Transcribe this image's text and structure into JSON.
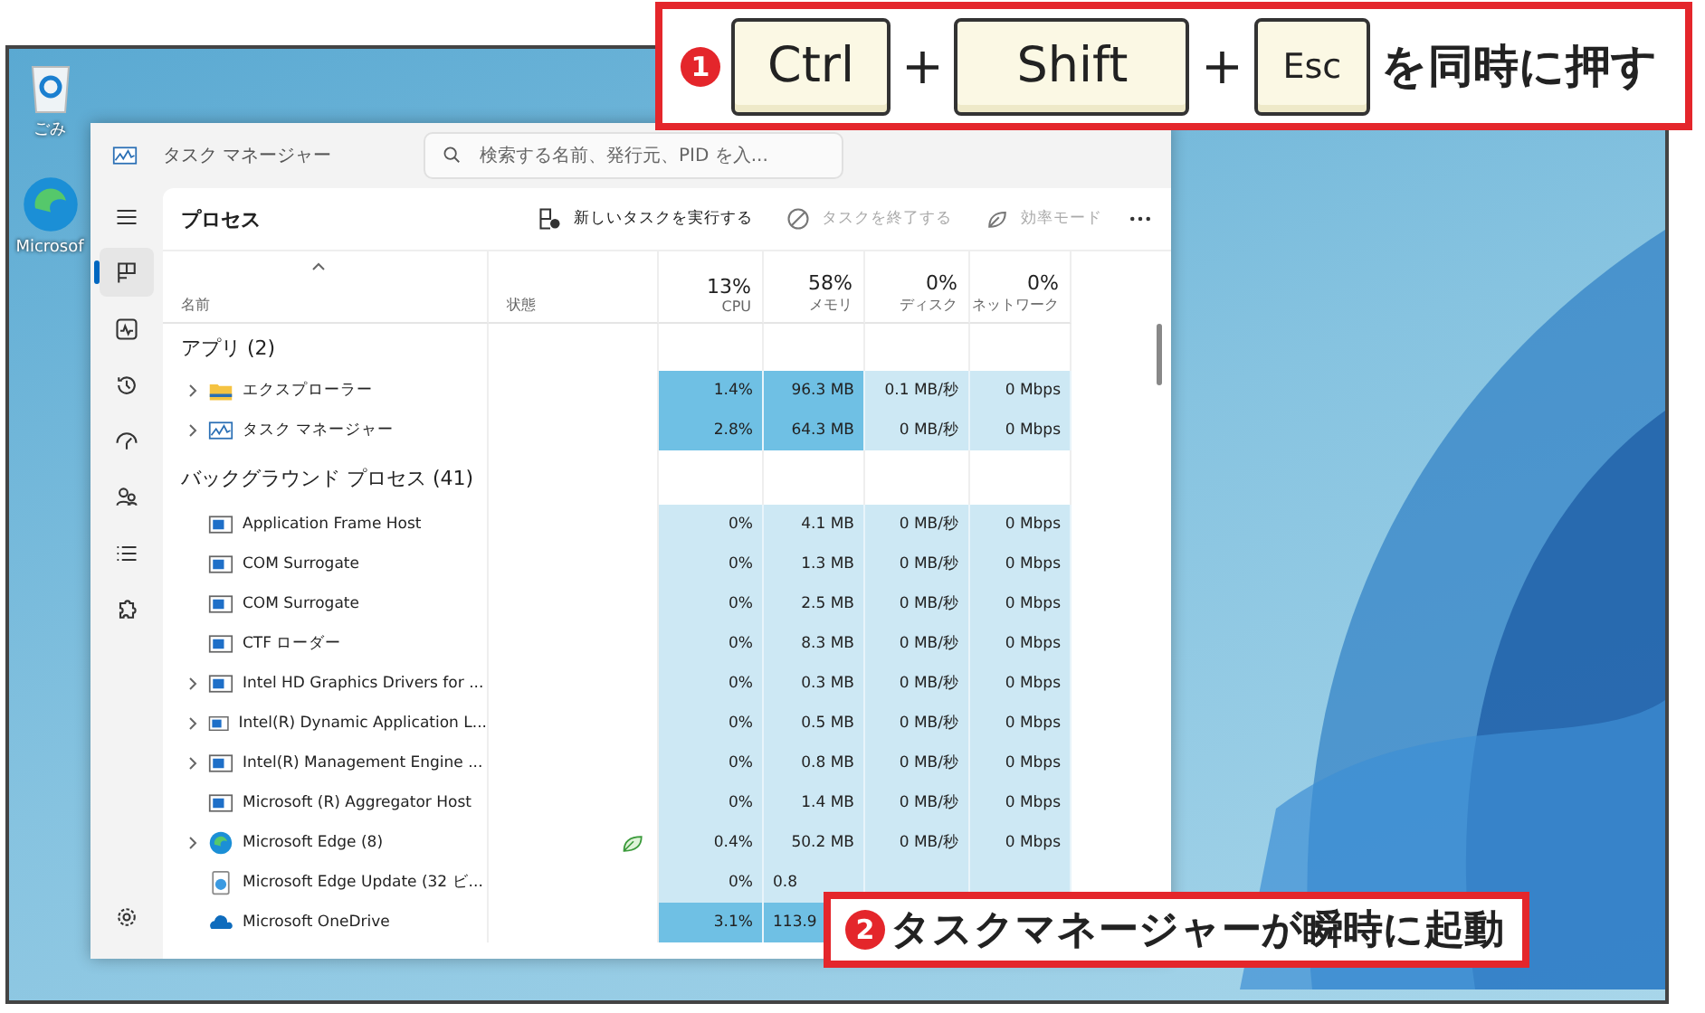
{
  "desktop": {
    "icons": [
      {
        "kind": "recycle",
        "label": "ごみ"
      },
      {
        "kind": "edge",
        "label": "Microsof"
      }
    ]
  },
  "window": {
    "title": "タスク マネージャー",
    "search": {
      "placeholder": "検索する名前、発行元、PID を入..."
    },
    "nav": [
      {
        "kind": "menu",
        "selected": false
      },
      {
        "kind": "processes",
        "selected": true
      },
      {
        "kind": "performance",
        "selected": false
      },
      {
        "kind": "history",
        "selected": false
      },
      {
        "kind": "startup",
        "selected": false
      },
      {
        "kind": "users",
        "selected": false
      },
      {
        "kind": "details",
        "selected": false
      },
      {
        "kind": "services",
        "selected": false
      },
      {
        "kind": "settings",
        "selected": false
      }
    ],
    "page_title": "プロセス",
    "toolbar": [
      {
        "kind": "run",
        "label": "新しいタスクを実行する",
        "disabled": false
      },
      {
        "kind": "end",
        "label": "タスクを終了する",
        "disabled": true
      },
      {
        "kind": "efficiency",
        "label": "効率モード",
        "disabled": true
      }
    ],
    "columns": [
      {
        "label": "名前"
      },
      {
        "label": "状態"
      },
      {
        "percent": "13%",
        "label": "CPU"
      },
      {
        "percent": "58%",
        "label": "メモリ"
      },
      {
        "percent": "0%",
        "label": "ディスク"
      },
      {
        "percent": "0%",
        "label": "ネットワーク"
      }
    ],
    "groups": [
      {
        "title": "アプリ (2)",
        "rows": [
          {
            "kind": "folder",
            "expandable": true,
            "name": "エクスプローラー",
            "efficiency": false,
            "heavy": true,
            "cpu": "1.4%",
            "memory": "96.3 MB",
            "disk": "0.1 MB/秒",
            "network": "0 Mbps"
          },
          {
            "kind": "taskmgr",
            "expandable": true,
            "name": "タスク マネージャー",
            "efficiency": false,
            "heavy": true,
            "cpu": "2.8%",
            "memory": "64.3 MB",
            "disk": "0 MB/秒",
            "network": "0 Mbps"
          }
        ]
      },
      {
        "title": "バックグラウンド プロセス (41)",
        "rows": [
          {
            "kind": "app",
            "expandable": false,
            "name": "Application Frame Host",
            "efficiency": false,
            "heavy": false,
            "cpu": "0%",
            "memory": "4.1 MB",
            "disk": "0 MB/秒",
            "network": "0 Mbps"
          },
          {
            "kind": "app",
            "expandable": false,
            "name": "COM Surrogate",
            "efficiency": false,
            "heavy": false,
            "cpu": "0%",
            "memory": "1.3 MB",
            "disk": "0 MB/秒",
            "network": "0 Mbps"
          },
          {
            "kind": "app",
            "expandable": false,
            "name": "COM Surrogate",
            "efficiency": false,
            "heavy": false,
            "cpu": "0%",
            "memory": "2.5 MB",
            "disk": "0 MB/秒",
            "network": "0 Mbps"
          },
          {
            "kind": "app",
            "expandable": false,
            "name": "CTF ローダー",
            "efficiency": false,
            "heavy": false,
            "cpu": "0%",
            "memory": "8.3 MB",
            "disk": "0 MB/秒",
            "network": "0 Mbps"
          },
          {
            "kind": "app",
            "expandable": true,
            "name": "Intel HD Graphics Drivers for ...",
            "efficiency": false,
            "heavy": false,
            "cpu": "0%",
            "memory": "0.3 MB",
            "disk": "0 MB/秒",
            "network": "0 Mbps"
          },
          {
            "kind": "app",
            "expandable": true,
            "name": "Intel(R) Dynamic Application L...",
            "efficiency": false,
            "heavy": false,
            "cpu": "0%",
            "memory": "0.5 MB",
            "disk": "0 MB/秒",
            "network": "0 Mbps"
          },
          {
            "kind": "app",
            "expandable": true,
            "name": "Intel(R) Management Engine ...",
            "efficiency": false,
            "heavy": false,
            "cpu": "0%",
            "memory": "0.8 MB",
            "disk": "0 MB/秒",
            "network": "0 Mbps"
          },
          {
            "kind": "app",
            "expandable": false,
            "name": "Microsoft (R) Aggregator Host",
            "efficiency": false,
            "heavy": false,
            "cpu": "0%",
            "memory": "1.4 MB",
            "disk": "0 MB/秒",
            "network": "0 Mbps"
          },
          {
            "kind": "edge",
            "expandable": true,
            "name": "Microsoft Edge (8)",
            "efficiency": true,
            "heavy": false,
            "cpu": "0.4%",
            "memory": "50.2 MB",
            "disk": "0 MB/秒",
            "network": "0 Mbps"
          },
          {
            "kind": "update",
            "expandable": false,
            "name": "Microsoft Edge Update (32 ビ...",
            "efficiency": false,
            "heavy": false,
            "cpu": "0%",
            "memory": "0.8"
          },
          {
            "kind": "onedrive",
            "expandable": false,
            "name": "Microsoft OneDrive",
            "efficiency": false,
            "heavy": true,
            "cpu": "3.1%",
            "memory": "113.9"
          }
        ]
      }
    ]
  },
  "callouts": [
    {
      "number": "1",
      "parts": [
        {
          "kind": "key",
          "text": "Ctrl"
        },
        {
          "kind": "plus",
          "text": "+"
        },
        {
          "kind": "key",
          "text": "Shift"
        },
        {
          "kind": "plus",
          "text": "+"
        },
        {
          "kind": "key",
          "text": "Esc"
        },
        {
          "kind": "text",
          "text": "を同時に押す"
        }
      ]
    },
    {
      "number": "2",
      "parts": [
        {
          "kind": "text",
          "text": "タスクマネージャーが瞬時に起動"
        }
      ]
    }
  ]
}
